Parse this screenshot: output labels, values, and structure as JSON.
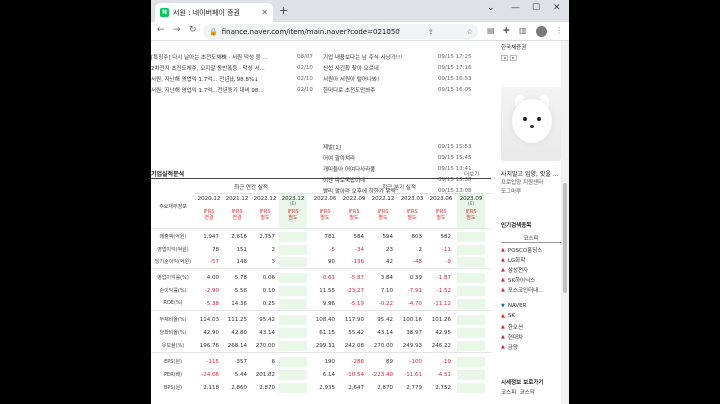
{
  "browser": {
    "tab_title": "서원 : 네이버페이 증권",
    "url": "finance.naver.com/item/main.naver?code=021050"
  },
  "news_left": [
    {
      "title": "[특징주] 다시 날아는 초전도체株 · 서원 덕성 등 ...",
      "date": "08/07"
    },
    {
      "title": "2차전지 초전도체주, 오지말 동반폭등 · 덕성 서...",
      "date": "02/10"
    },
    {
      "title": "서원, 자난해 영업익 1.7억... 전년比 98.8%↓",
      "date": "02/10"
    },
    {
      "title": "서원, 지난해 영업익 1.7억...전년동기 대비 98...",
      "date": "02/10"
    }
  ],
  "news_right": [
    {
      "title": "기업 내용보다는 남 주식 사냥가!!!",
      "date": "09/15 17:25"
    },
    {
      "title": "신섭 사긴확 찾아 오르네",
      "date": "09/15 17:16"
    },
    {
      "title": "서원아 서원아 털어나봐!",
      "date": "09/15 16:53"
    },
    {
      "title": "한미다로 초전도만봐주",
      "date": "09/15 16:05"
    },
    {
      "title": "제발[1]",
      "date": "09/15 15:53"
    },
    {
      "title": "어여 팔아쳐라",
      "date": "09/15 15:45"
    },
    {
      "title": "개미들아 어여다사라풀",
      "date": "09/15 13:41"
    },
    {
      "title": "이젠 따로국밥이네",
      "date": "09/15 13:38"
    },
    {
      "title": "빨리 팔아라 오후에 하한가 유력",
      "date": "09/15 13:08"
    }
  ],
  "fin": {
    "section_title": "기업실적분석",
    "more": "더보기",
    "row_header": "주요재무정보",
    "annual_label": "최근 연간 실적",
    "quarter_label": "최근 분기 실적",
    "cols": [
      {
        "period": "2020.12",
        "ifrs": "IFRS",
        "sub": "연결"
      },
      {
        "period": "2021.12",
        "ifrs": "IFRS",
        "sub": "연결"
      },
      {
        "period": "2022.12",
        "ifrs": "IFRS",
        "sub": "별도"
      },
      {
        "period": "2023.12",
        "ifrs": "IFRS",
        "sub": "별도",
        "estimate": "(E)"
      },
      {
        "period": "2022.06",
        "ifrs": "IFRS",
        "sub": "별도"
      },
      {
        "period": "2022.09",
        "ifrs": "IFRS",
        "sub": "별도"
      },
      {
        "period": "2022.12",
        "ifrs": "IFRS",
        "sub": "별도"
      },
      {
        "period": "2023.03",
        "ifrs": "IFRS",
        "sub": "별도"
      },
      {
        "period": "2023.06",
        "ifrs": "IFRS",
        "sub": "별도"
      },
      {
        "period": "2023.09",
        "ifrs": "IFRS",
        "sub": "별도",
        "estimate": "(E)"
      }
    ],
    "rows": [
      {
        "label": "매출액(억원)",
        "vals": [
          "1,947",
          "2,616",
          "2,757",
          "",
          "781",
          "584",
          "594",
          "603",
          "582",
          ""
        ]
      },
      {
        "label": "영업이익(억원)",
        "vals": [
          "78",
          "151",
          "2",
          "",
          "-5",
          "-34",
          "23",
          "2",
          "-11",
          ""
        ]
      },
      {
        "label": "당기순이익(억원)",
        "vals": [
          "-57",
          "146",
          "3",
          "",
          "90",
          "-136",
          "42",
          "-48",
          "-9",
          ""
        ]
      },
      {
        "label": "영업이익률(%)",
        "vals": [
          "4.00",
          "5.78",
          "0.06",
          "",
          "-0.61",
          "-5.87",
          "3.84",
          "0.39",
          "-1.87",
          ""
        ]
      },
      {
        "label": "순이익률(%)",
        "vals": [
          "-2.90",
          "5.58",
          "0.10",
          "",
          "11.55",
          "-23.27",
          "7.10",
          "-7.91",
          "-1.52",
          ""
        ]
      },
      {
        "label": "ROE(%)",
        "vals": [
          "-5.38",
          "14.36",
          "0.25",
          "",
          "9.96",
          "-5.19",
          "-0.22",
          "-4.70",
          "-11.12",
          ""
        ]
      },
      {
        "label": "부채비율(%)",
        "vals": [
          "114.03",
          "111.25",
          "95.42",
          "",
          "108.40",
          "117.90",
          "95.42",
          "100.16",
          "101.26",
          ""
        ]
      },
      {
        "label": "당좌비율(%)",
        "vals": [
          "42.90",
          "42.80",
          "43.14",
          "",
          "61.15",
          "55.42",
          "43.14",
          "38.97",
          "42.95",
          ""
        ]
      },
      {
        "label": "유보율(%)",
        "vals": [
          "196.76",
          "268.14",
          "270.00",
          "",
          "299.31",
          "242.08",
          "270.00",
          "249.93",
          "246.22",
          ""
        ]
      },
      {
        "label": "EPS(원)",
        "vals": [
          "-115",
          "357",
          "6",
          "",
          "190",
          "-286",
          "89",
          "-100",
          "-19",
          ""
        ]
      },
      {
        "label": "PER(배)",
        "vals": [
          "-24.06",
          "5.44",
          "201.82",
          "",
          "6.14",
          "-10.54",
          "-223.40",
          "-11.61",
          "-4.51",
          ""
        ]
      },
      {
        "label": "BPS(원)",
        "vals": [
          "2,118",
          "2,860",
          "2,870",
          "",
          "2,935",
          "2,647",
          "2,870",
          "2,779",
          "2,752",
          ""
        ]
      }
    ]
  },
  "side": {
    "company_label": "한국채증권",
    "ad_caption_1": "사치말고 입양, 맛을 ...",
    "ad_caption_2": "프로입양 지원센터",
    "ad_caption_3": "도그마루",
    "popular_title": "인기검색종목",
    "market_label": "코스피",
    "items": [
      {
        "name": "POSCO홀딩스",
        "dir": "up"
      },
      {
        "name": "LG화학",
        "dir": "up"
      },
      {
        "name": "삼성전자",
        "dir": "up"
      },
      {
        "name": "SK하이닉스",
        "dir": "up"
      },
      {
        "name": "포스코인터내...",
        "dir": "up"
      },
      {
        "name": "NAVER",
        "dir": "down"
      },
      {
        "name": "SK",
        "dir": "up"
      },
      {
        "name": "한오션",
        "dir": "up"
      },
      {
        "name": "현대차",
        "dir": "up"
      },
      {
        "name": "금양",
        "dir": "up"
      }
    ],
    "bottom_title": "시세정보 보로가기",
    "bottom_tab1": "코스피",
    "bottom_tab2": "코스닥"
  }
}
